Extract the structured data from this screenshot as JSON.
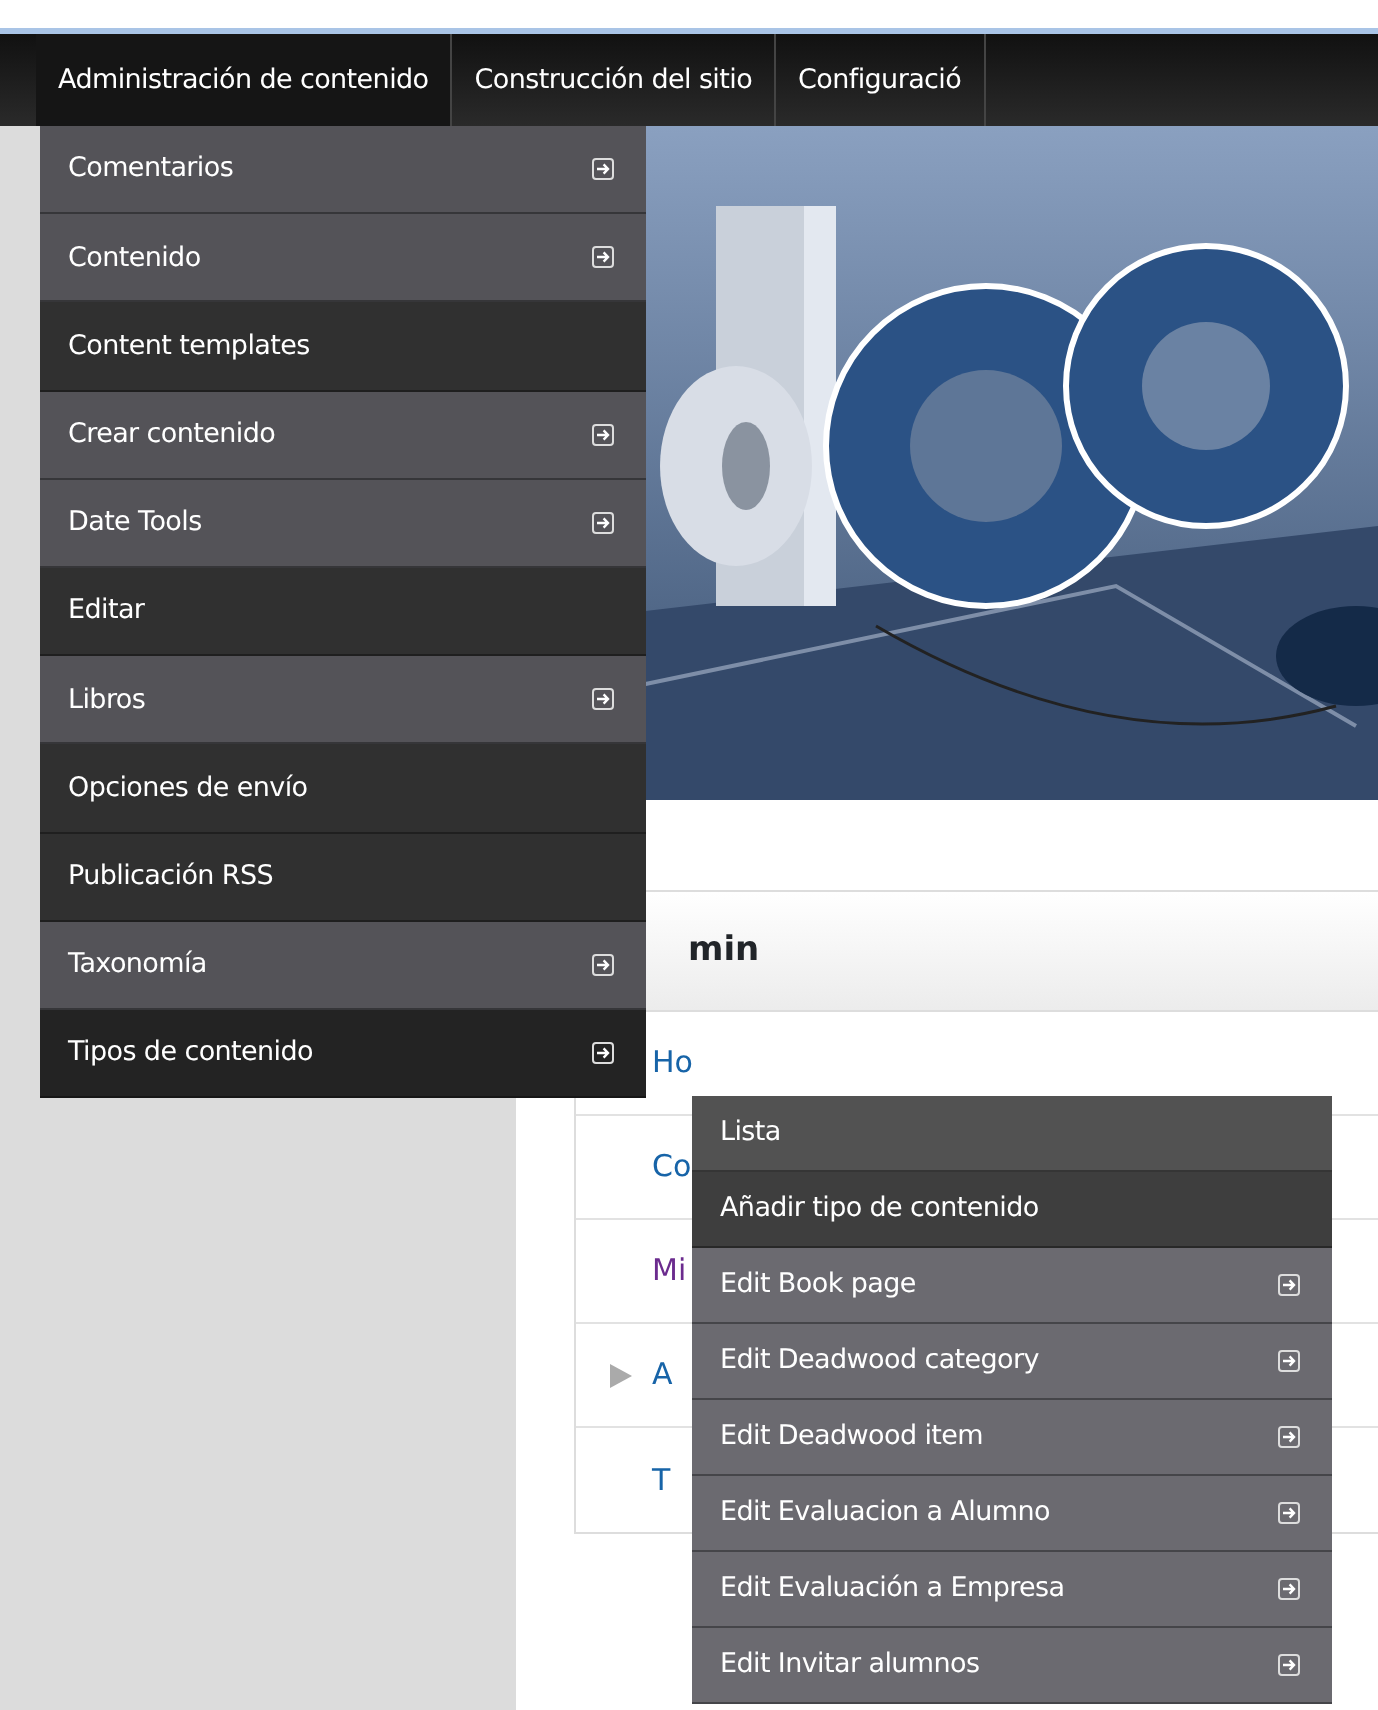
{
  "top_menu": [
    {
      "label": "Administración de contenido",
      "selected": true
    },
    {
      "label": "Construcción del sitio",
      "selected": false
    },
    {
      "label": "Configuració",
      "selected": false
    }
  ],
  "dropdown": [
    {
      "label": "Comentarios",
      "has_submenu": true,
      "selected": false
    },
    {
      "label": "Contenido",
      "has_submenu": true,
      "selected": false
    },
    {
      "label": "Content templates",
      "has_submenu": false,
      "selected": false
    },
    {
      "label": "Crear contenido",
      "has_submenu": true,
      "selected": false
    },
    {
      "label": "Date Tools",
      "has_submenu": true,
      "selected": false
    },
    {
      "label": "Editar",
      "has_submenu": false,
      "selected": false
    },
    {
      "label": "Libros",
      "has_submenu": true,
      "selected": false
    },
    {
      "label": "Opciones de envío",
      "has_submenu": false,
      "selected": false
    },
    {
      "label": "Publicación RSS",
      "has_submenu": false,
      "selected": false
    },
    {
      "label": "Taxonomía",
      "has_submenu": true,
      "selected": false
    },
    {
      "label": "Tipos de contenido",
      "has_submenu": true,
      "selected": true
    }
  ],
  "submenu": [
    {
      "label": "Lista",
      "has_submenu": false,
      "selected": false
    },
    {
      "label": "Añadir tipo de contenido",
      "has_submenu": false,
      "selected": true
    },
    {
      "label": "Edit Book page",
      "has_submenu": true,
      "selected": false
    },
    {
      "label": "Edit Deadwood category",
      "has_submenu": true,
      "selected": false
    },
    {
      "label": "Edit Deadwood item",
      "has_submenu": true,
      "selected": false
    },
    {
      "label": "Edit Evaluacion a Alumno",
      "has_submenu": true,
      "selected": false
    },
    {
      "label": "Edit Evaluación a Empresa",
      "has_submenu": true,
      "selected": false
    },
    {
      "label": "Edit Invitar alumnos",
      "has_submenu": true,
      "selected": false
    }
  ],
  "user_block": {
    "title": "min",
    "links": [
      {
        "label": "Ho",
        "visited": false,
        "kind": "leaf"
      },
      {
        "label": "Co",
        "visited": false,
        "kind": "leaf"
      },
      {
        "label": "Mi",
        "visited": true,
        "kind": "leaf"
      },
      {
        "label": "A",
        "visited": false,
        "kind": "expandable"
      },
      {
        "label": "T",
        "visited": false,
        "kind": "leaf"
      }
    ]
  }
}
